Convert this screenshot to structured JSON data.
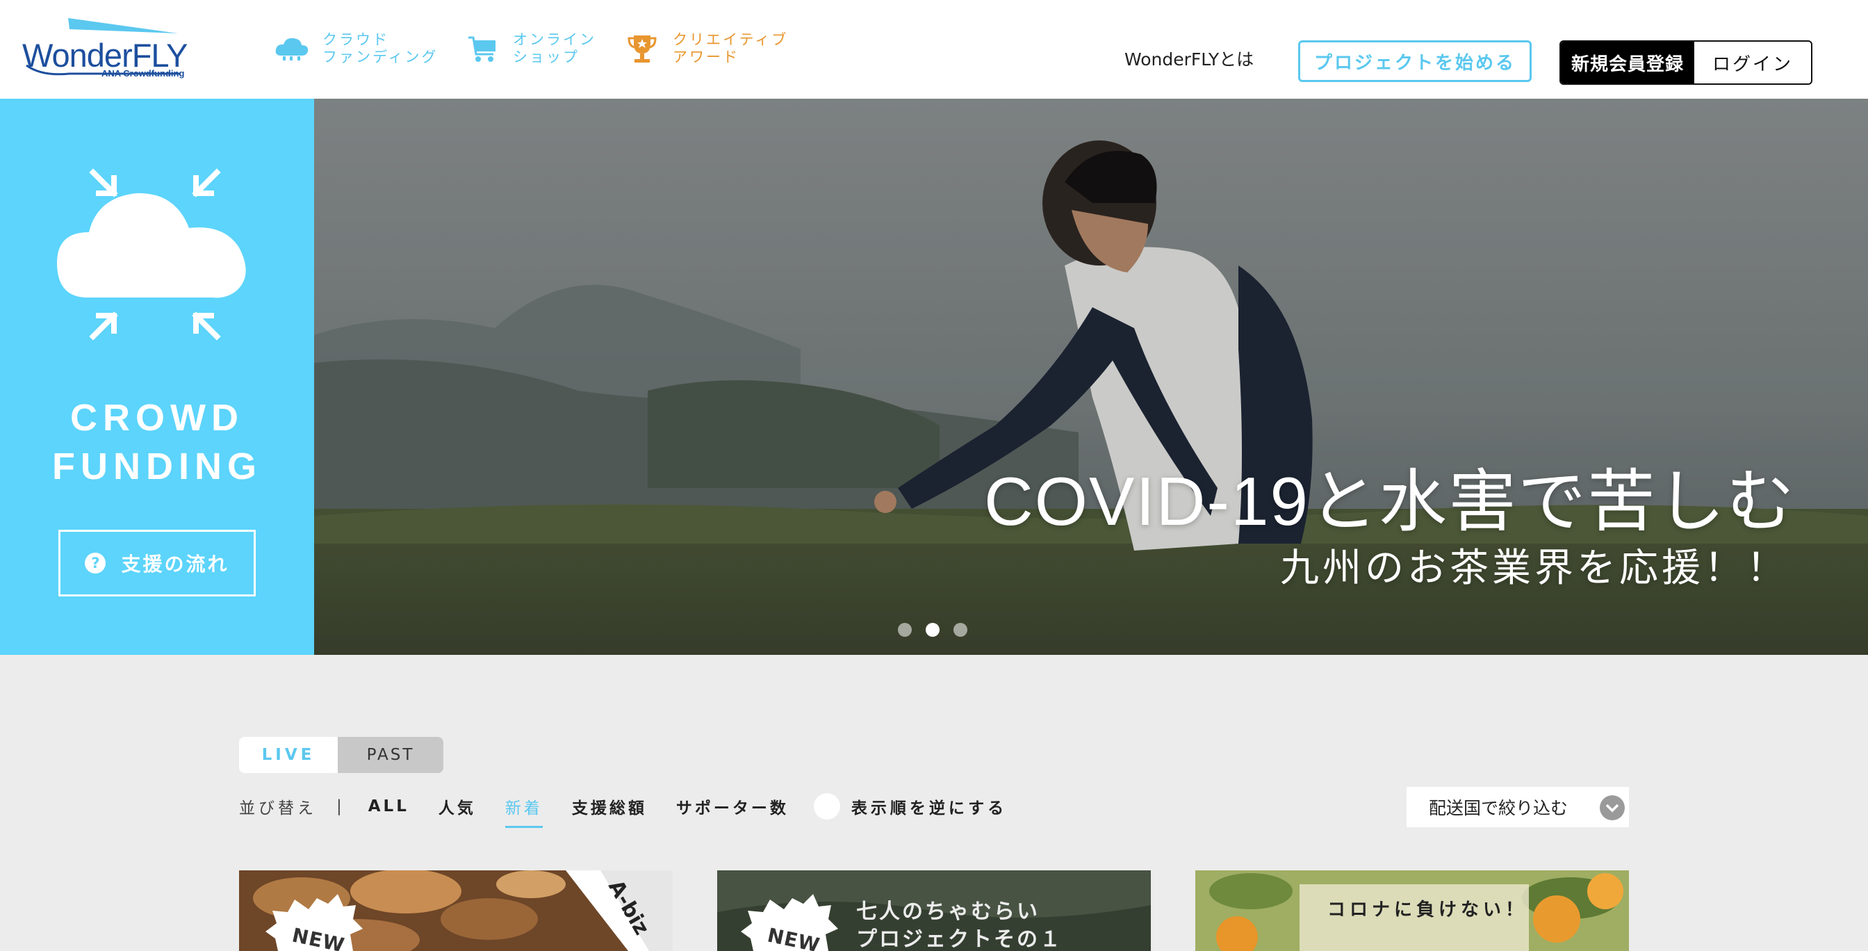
{
  "header": {
    "logo": {
      "wordmark": "WonderFLY",
      "subtitle": "ANA Crowdfunding"
    },
    "nav": [
      {
        "label": "クラウド\nファンディング",
        "icon": "cloud-icon",
        "color": "#5bc8ef"
      },
      {
        "label": "オンライン\nショップ",
        "icon": "cart-icon",
        "color": "#5bc8ef"
      },
      {
        "label": "クリエイティブ\nアワード",
        "icon": "trophy-icon",
        "color": "#e8962f"
      }
    ],
    "about_label": "WonderFLYとは",
    "start_project_label": "プロジェクトを始める",
    "signup_label": "新規会員登録",
    "login_label": "ログイン"
  },
  "hero_side": {
    "title": "CROWD\nFUNDING",
    "support_flow_label": "支援の流れ",
    "accent_color": "#5cd4fb"
  },
  "hero": {
    "title": "COVID-19と水害で苦しむ",
    "subtitle": "九州のお茶業界を応援！！",
    "slide_count": 3,
    "active_slide": 2
  },
  "listing": {
    "tabs": [
      {
        "label": "LIVE",
        "active": true
      },
      {
        "label": "PAST",
        "active": false
      }
    ],
    "sort_label": "並び替え",
    "sort_separator": "|",
    "sort_options": [
      {
        "label": "ALL",
        "active": false
      },
      {
        "label": "人気",
        "active": false
      },
      {
        "label": "新着",
        "active": true
      },
      {
        "label": "支援総額",
        "active": false
      },
      {
        "label": "サポーター数",
        "active": false
      }
    ],
    "reverse_label": "表示順を逆にする",
    "country_filter_label": "配送国で絞り込む"
  },
  "cards": [
    {
      "badge": "NEW",
      "overlay_text": "A-biz"
    },
    {
      "badge": "NEW",
      "overlay_text": "七人のちゃむらい\nプロジェクトその１"
    },
    {
      "badge": "",
      "overlay_text": "コロナに負けない！"
    }
  ]
}
